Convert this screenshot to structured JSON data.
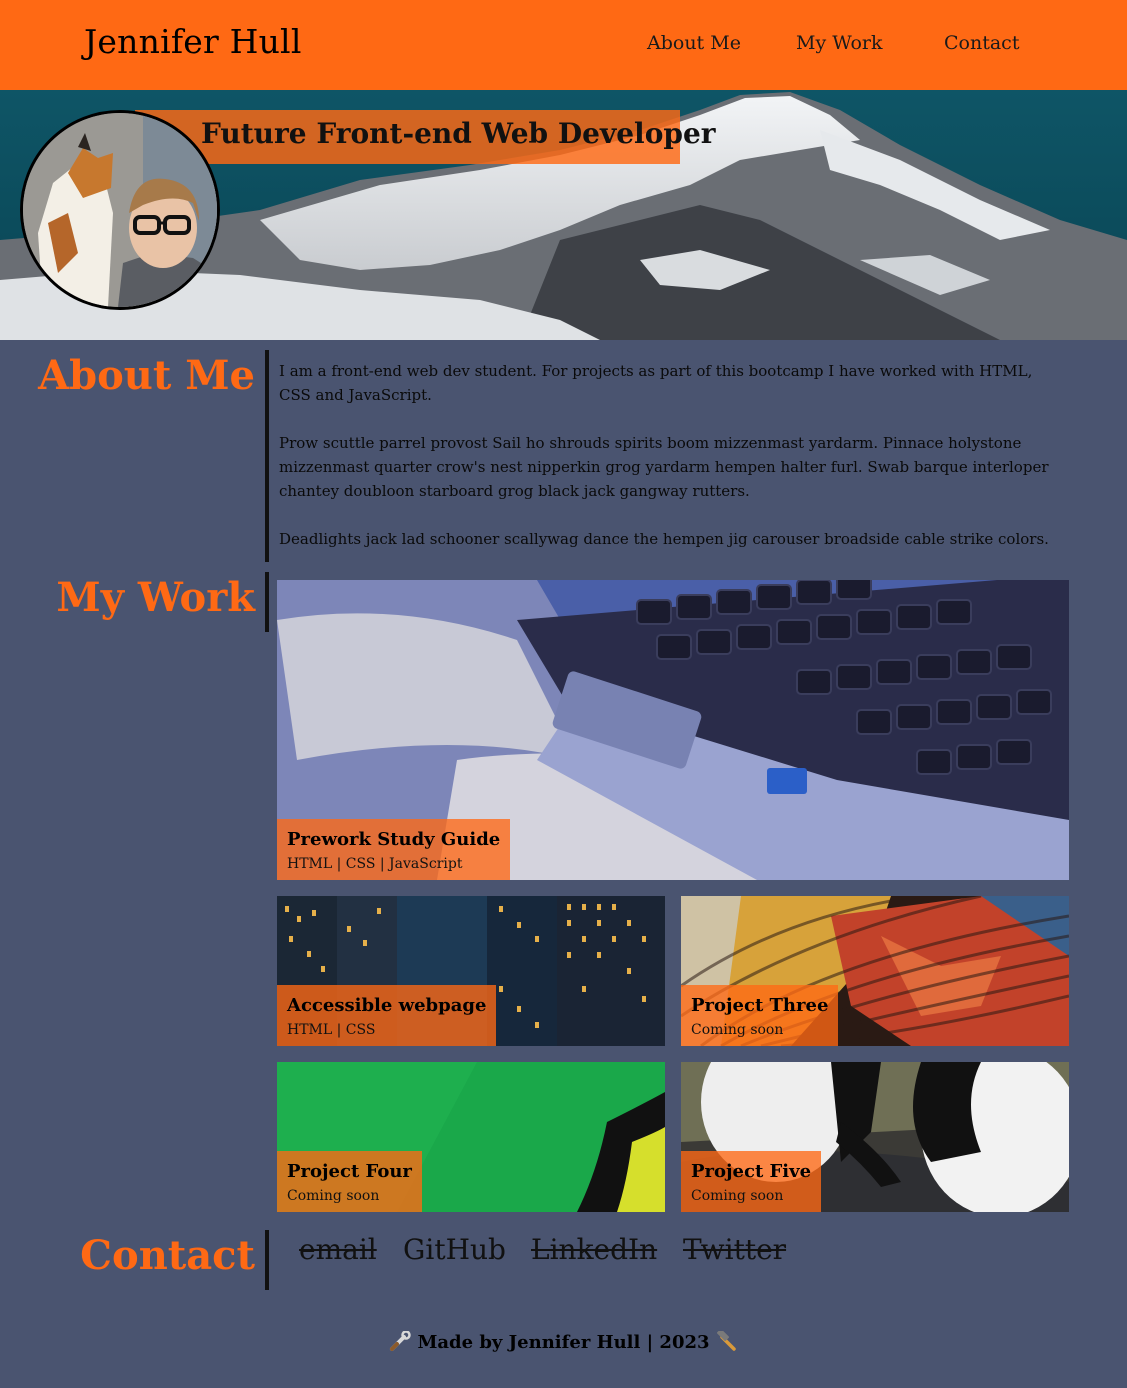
{
  "header": {
    "site_name": "Jennifer Hull",
    "nav": [
      {
        "label": "About Me"
      },
      {
        "label": "My Work"
      },
      {
        "label": "Contact"
      }
    ],
    "brand_color": "#ff6914"
  },
  "hero": {
    "title": "Future Front-end Web Developer"
  },
  "about": {
    "heading": "About Me",
    "paragraphs": [
      "I am a front-end web dev student. For projects as part of this bootcamp I have worked with HTML, CSS and JavaScript.",
      "Prow scuttle parrel provost Sail ho shrouds spirits boom mizzenmast yardarm. Pinnace holystone mizzenmast quarter crow's nest nipperkin grog yardarm hempen halter furl. Swab barque interloper chantey doubloon starboard grog black jack gangway rutters.",
      "Deadlights jack lad schooner scallywag dance the hempen jig carouser broadside cable strike colors."
    ]
  },
  "work": {
    "heading": "My Work",
    "projects": [
      {
        "title": "Prework Study Guide",
        "tech": "HTML | CSS | JavaScript"
      },
      {
        "title": "Accessible webpage",
        "tech": "HTML | CSS"
      },
      {
        "title": "Project Three",
        "tech": "Coming soon"
      },
      {
        "title": "Project Four",
        "tech": "Coming soon"
      },
      {
        "title": "Project Five",
        "tech": "Coming soon"
      }
    ]
  },
  "contact": {
    "heading": "Contact",
    "links": [
      {
        "label": "email",
        "struck": true
      },
      {
        "label": "GitHub",
        "struck": false
      },
      {
        "label": "LinkedIn",
        "struck": true
      },
      {
        "label": "Twitter",
        "struck": true
      }
    ]
  },
  "footer": {
    "text": "Made by Jennifer Hull | 2023",
    "left_icon": "wrench-icon",
    "right_icon": "hammer-icon"
  },
  "colors": {
    "background": "#4a5470",
    "accent": "#ff6914"
  }
}
